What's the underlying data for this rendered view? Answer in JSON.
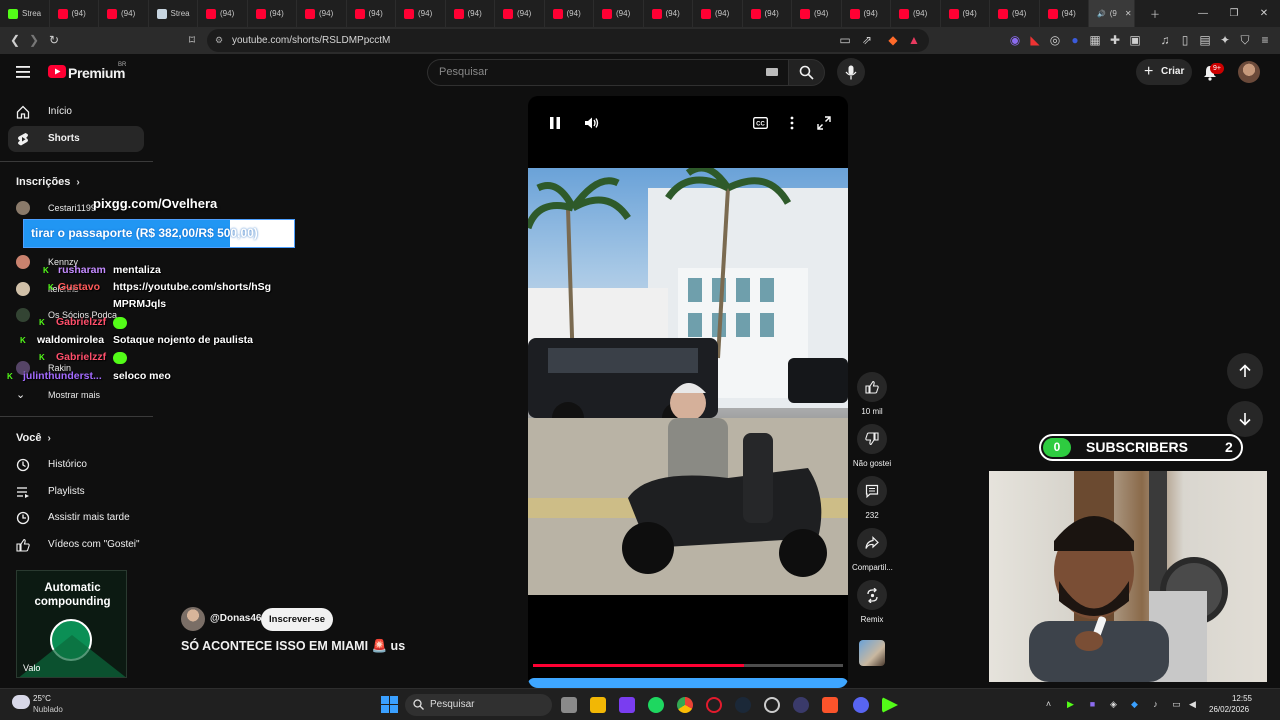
{
  "browser": {
    "tabs": [
      {
        "label": "Strea",
        "icon": "kick-icon",
        "color": "#53fc18"
      },
      {
        "label": "(94)",
        "icon": "youtube-icon",
        "color": "#ff0033"
      },
      {
        "label": "(94)",
        "icon": "youtube-icon",
        "color": "#ff0033"
      },
      {
        "label": "Strea",
        "icon": "steam-icon",
        "color": "#c7d5e0"
      },
      {
        "label": "(94)",
        "icon": "youtube-icon",
        "color": "#ff0033"
      },
      {
        "label": "(94)",
        "icon": "youtube-icon",
        "color": "#ff0033"
      },
      {
        "label": "(94)",
        "icon": "youtube-icon",
        "color": "#ff0033"
      },
      {
        "label": "(94)",
        "icon": "youtube-icon",
        "color": "#ff0033"
      },
      {
        "label": "(94)",
        "icon": "youtube-icon",
        "color": "#ff0033"
      },
      {
        "label": "(94)",
        "icon": "youtube-icon",
        "color": "#ff0033"
      },
      {
        "label": "(94)",
        "icon": "youtube-icon",
        "color": "#ff0033"
      },
      {
        "label": "(94)",
        "icon": "youtube-icon",
        "color": "#ff0033"
      },
      {
        "label": "(94)",
        "icon": "youtube-icon",
        "color": "#ff0033"
      },
      {
        "label": "(94)",
        "icon": "youtube-icon",
        "color": "#ff0033"
      },
      {
        "label": "(94)",
        "icon": "youtube-icon",
        "color": "#ff0033"
      },
      {
        "label": "(94)",
        "icon": "youtube-icon",
        "color": "#ff0033"
      },
      {
        "label": "(94)",
        "icon": "youtube-icon",
        "color": "#ff0033"
      },
      {
        "label": "(94)",
        "icon": "youtube-icon",
        "color": "#ff0033"
      },
      {
        "label": "(94)",
        "icon": "youtube-icon",
        "color": "#ff0033"
      },
      {
        "label": "(94)",
        "icon": "youtube-icon",
        "color": "#ff0033"
      },
      {
        "label": "(94)",
        "icon": "youtube-icon",
        "color": "#ff0033"
      },
      {
        "label": "(94)",
        "icon": "youtube-icon",
        "color": "#ff0033"
      }
    ],
    "active_tab": {
      "label": "(9",
      "icon": "speaker-icon"
    },
    "url": "youtube.com/shorts/RSLDMPpcctM"
  },
  "youtube": {
    "logo_text": "Premium",
    "country": "BR",
    "search_placeholder": "Pesquisar",
    "create_label": "Criar",
    "notif_count": "9+",
    "brand_red": "#ff0033"
  },
  "sidebar": {
    "items": [
      {
        "label": "Início",
        "icon": "home-icon"
      },
      {
        "label": "Shorts",
        "icon": "shorts-icon"
      }
    ],
    "subscriptions_heading": "Inscrições",
    "subscriptions": [
      {
        "name": "Cestari1199"
      },
      {
        "name": "Kennzy"
      },
      {
        "name": "itelchris"
      },
      {
        "name": "Os Sócios Podca"
      },
      {
        "name": "Rakin"
      }
    ],
    "show_more": "Mostrar mais",
    "you_heading": "Você",
    "you_items": [
      {
        "label": "Histórico",
        "icon": "history-icon"
      },
      {
        "label": "Playlists",
        "icon": "playlists-icon"
      },
      {
        "label": "Assistir mais tarde",
        "icon": "watch-later-icon"
      },
      {
        "label": "Vídeos com \"Gostei\"",
        "icon": "like-icon"
      }
    ]
  },
  "overlay": {
    "goal_site": "pixgg.com/Ovelhera",
    "goal_label": "tirar o passaporte (R$ 382,00/R$ 500,00)",
    "goal_progress": 0.764,
    "chat": [
      {
        "user": "rusharam",
        "user_color": "#c48bff",
        "text": "mentaliza"
      },
      {
        "user": "Gustavo",
        "user_color": "#ff5a5a",
        "text": "https://youtube.com/shorts/hSg"
      },
      {
        "user": "",
        "user_color": "#ffffff",
        "text": "MPRMJqls"
      },
      {
        "user": "Gabrielzzf",
        "user_color": "#ff4f6b",
        "text": ""
      },
      {
        "user": "waldomirolea",
        "user_color": "#ffffff",
        "text": "Sotaque nojento de paulista"
      },
      {
        "user": "Gabrielzzf",
        "user_color": "#ff4f6b",
        "text": ""
      },
      {
        "user": "julinthunderst...",
        "user_color": "#a36bff",
        "text": "seloco meo"
      }
    ]
  },
  "player": {
    "progress": 0.68
  },
  "actions": [
    {
      "label": "10 mil",
      "icon": "thumbs-up-icon"
    },
    {
      "label": "Não gostei",
      "icon": "thumbs-down-icon"
    },
    {
      "label": "232",
      "icon": "comment-icon"
    },
    {
      "label": "Compartil...",
      "icon": "share-icon"
    },
    {
      "label": "Remix",
      "icon": "remix-icon"
    }
  ],
  "video": {
    "channel": "@Donas46",
    "subscribe_label": "Inscrever-se",
    "title": "SÓ ACONTECE ISSO EM MIAMI 🚨 us"
  },
  "subs_widget": {
    "left_count": "0",
    "label": "SUBSCRIBERS",
    "right_count": "2",
    "accent": "#2ecc40"
  },
  "ad": {
    "title": "Automatic compounding",
    "brand": "Valo"
  },
  "taskbar": {
    "temperature": "25°C",
    "weather": "Nublado",
    "search_placeholder": "Pesquisar",
    "time": "12:55",
    "date": "26/02/2026"
  }
}
